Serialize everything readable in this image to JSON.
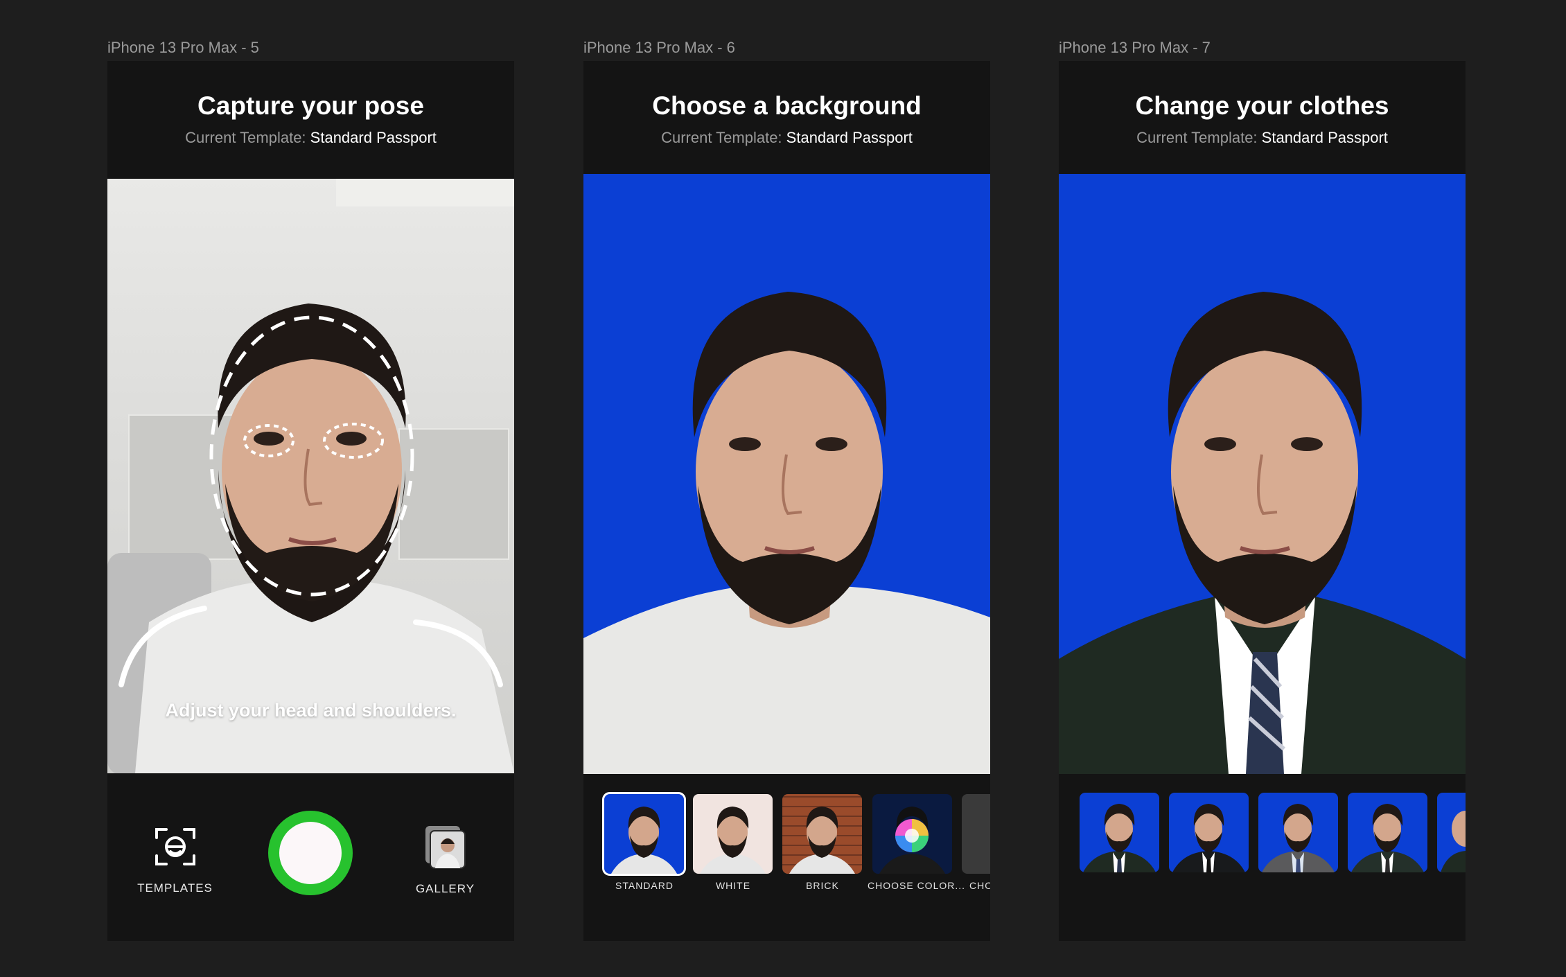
{
  "frames": [
    {
      "label": "iPhone 13 Pro Max - 5",
      "title": "Capture your pose",
      "sub_label": "Current Template:",
      "sub_value": "Standard Passport"
    },
    {
      "label": "iPhone 13 Pro Max - 6",
      "title": "Choose a background",
      "sub_label": "Current Template:",
      "sub_value": "Standard Passport"
    },
    {
      "label": "iPhone 13 Pro Max - 7",
      "title": "Change your clothes",
      "sub_label": "Current Template:",
      "sub_value": "Standard Passport"
    }
  ],
  "capture": {
    "hint": "Adjust your head and shoulders.",
    "templates_label": "TEMPLATES",
    "gallery_label": "GALLERY",
    "shutter_color": "#27c22e"
  },
  "backgrounds": {
    "options": [
      "STANDARD",
      "WHITE",
      "BRICK",
      "CHOOSE COLOR...",
      "CHO"
    ],
    "selected": "STANDARD",
    "bg_color": "#0b3fd4"
  },
  "clothes": {
    "count_visible": 5
  },
  "icons": {
    "templates": "face-scan-icon",
    "gallery": "gallery-photo-icon"
  }
}
